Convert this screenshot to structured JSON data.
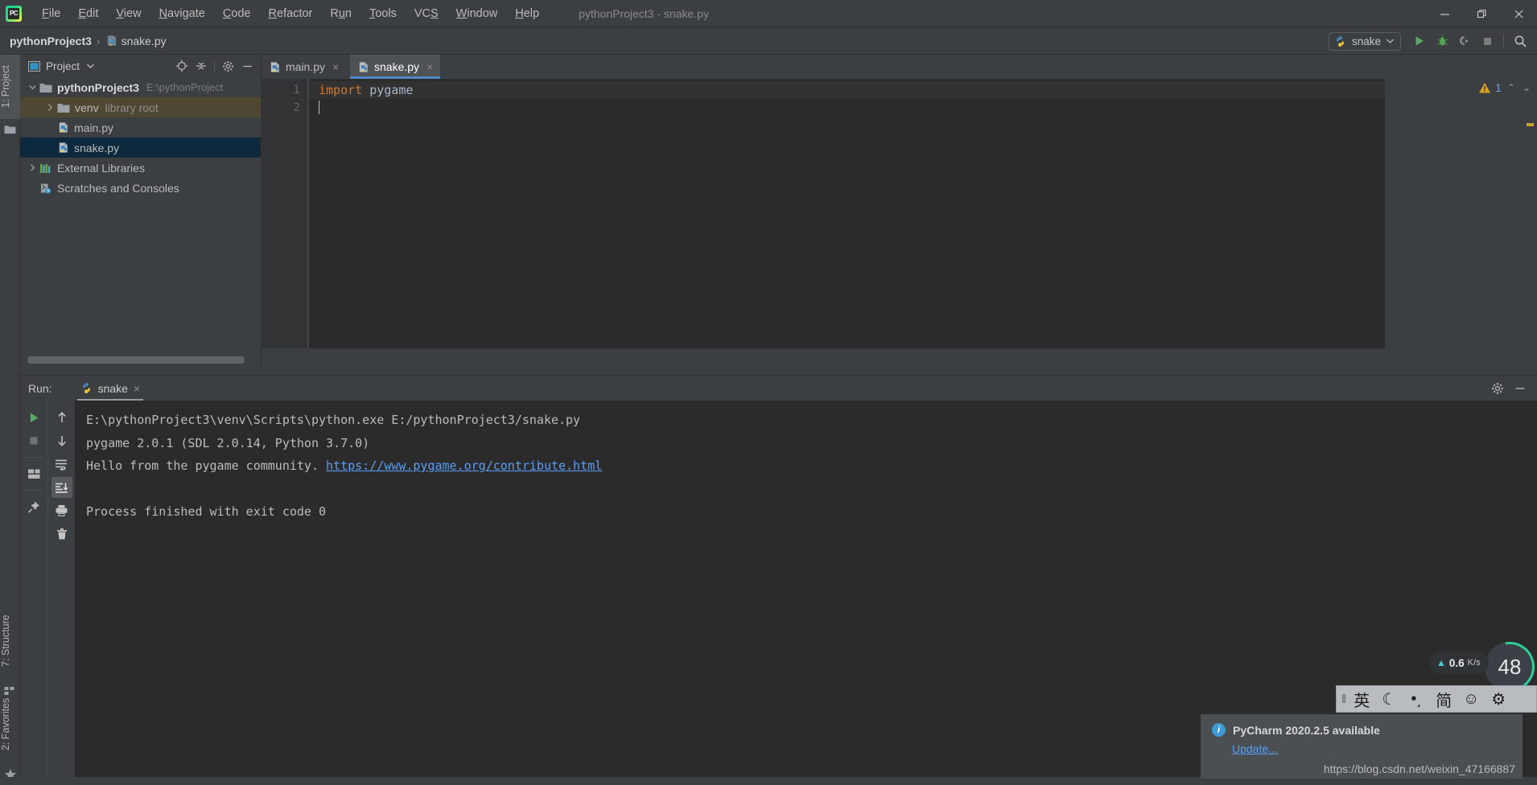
{
  "window": {
    "title": "pythonProject3 - snake.py",
    "app_logo": "pycharm-logo",
    "controls": {
      "minimize": "minimize-icon",
      "maximize": "restore-icon",
      "close": "close-icon"
    }
  },
  "menubar": {
    "items": [
      {
        "label": "File",
        "mnemonic": "F"
      },
      {
        "label": "Edit",
        "mnemonic": "E"
      },
      {
        "label": "View",
        "mnemonic": "V"
      },
      {
        "label": "Navigate",
        "mnemonic": "N"
      },
      {
        "label": "Code",
        "mnemonic": "C"
      },
      {
        "label": "Refactor",
        "mnemonic": "R"
      },
      {
        "label": "Run",
        "mnemonic": "u"
      },
      {
        "label": "Tools",
        "mnemonic": "T"
      },
      {
        "label": "VCS",
        "mnemonic": "S"
      },
      {
        "label": "Window",
        "mnemonic": "W"
      },
      {
        "label": "Help",
        "mnemonic": "H"
      }
    ]
  },
  "navbar": {
    "breadcrumb": {
      "project": "pythonProject3",
      "separator": "›",
      "file": "snake.py"
    },
    "run_config": {
      "name": "snake",
      "icon": "python-icon",
      "chevron": "chevron-down-icon"
    },
    "actions": [
      {
        "name": "run-button",
        "icon": "play-icon",
        "tooltip": "Run"
      },
      {
        "name": "debug-button",
        "icon": "bug-icon",
        "tooltip": "Debug"
      },
      {
        "name": "coverage-button",
        "icon": "coverage-icon",
        "tooltip": "Run with Coverage"
      },
      {
        "name": "stop-button",
        "icon": "stop-icon",
        "tooltip": "Stop"
      },
      {
        "name": "search-button",
        "icon": "search-icon",
        "tooltip": "Search Everywhere"
      }
    ]
  },
  "left_strip": {
    "tabs": [
      {
        "label": "1: Project",
        "icon": "folder-icon",
        "selected": true
      },
      {
        "label": "7: Structure",
        "icon": "structure-icon",
        "selected": false
      },
      {
        "label": "2: Favorites",
        "icon": "star-icon",
        "selected": false
      }
    ]
  },
  "project_panel": {
    "title": "Project",
    "chevron": "chevron-down-icon",
    "tools": [
      {
        "name": "select-opened-file-button",
        "icon": "target-icon"
      },
      {
        "name": "collapse-all-button",
        "icon": "collapse-all-icon"
      },
      {
        "name": "settings-button",
        "icon": "gear-icon"
      },
      {
        "name": "hide-button",
        "icon": "minimize-icon"
      }
    ],
    "tree": [
      {
        "label": "pythonProject3",
        "detail": "E:\\pythonProject",
        "icon": "folder-icon",
        "arrow": "expanded",
        "indent": 0,
        "bold": true,
        "state": "none"
      },
      {
        "label": "venv",
        "detail": "library root",
        "icon": "folder-icon",
        "arrow": "collapsed",
        "indent": 1,
        "bold": false,
        "state": "venv"
      },
      {
        "label": "main.py",
        "detail": "",
        "icon": "python-icon",
        "arrow": "none",
        "indent": 2,
        "bold": false,
        "state": "none"
      },
      {
        "label": "snake.py",
        "detail": "",
        "icon": "python-icon",
        "arrow": "none",
        "indent": 2,
        "bold": false,
        "state": "selected"
      },
      {
        "label": "External Libraries",
        "detail": "",
        "icon": "library-icon",
        "arrow": "collapsed",
        "indent": 0,
        "bold": false,
        "state": "none"
      },
      {
        "label": "Scratches and Consoles",
        "detail": "",
        "icon": "scratch-icon",
        "arrow": "none",
        "indent": 0,
        "bold": false,
        "state": "none"
      }
    ]
  },
  "editor": {
    "tabs": [
      {
        "label": "main.py",
        "icon": "python-icon",
        "active": false,
        "close": "×"
      },
      {
        "label": "snake.py",
        "icon": "python-icon",
        "active": true,
        "close": "×"
      }
    ],
    "line_numbers": [
      "1",
      "2"
    ],
    "lines": [
      {
        "text": "import pygame",
        "current": true
      },
      {
        "text": "",
        "current": false
      }
    ],
    "inspection": {
      "warning_icon": "warning-triangle-icon",
      "warning_count": "1",
      "up": "⌃",
      "down": "⌄"
    }
  },
  "run_panel": {
    "header_label": "Run:",
    "tab": {
      "label": "snake",
      "icon": "python-icon",
      "close": "×"
    },
    "header_actions": [
      {
        "name": "run-settings-button",
        "icon": "gear-icon"
      },
      {
        "name": "hide-panel-button",
        "icon": "minimize-icon"
      }
    ],
    "toolbar_left": [
      {
        "name": "rerun-button",
        "icon": "play-icon"
      },
      {
        "name": "stop-button",
        "icon": "stop-icon"
      },
      {
        "name": "layout-button",
        "icon": "layout-icon"
      },
      {
        "name": "pin-tab-button",
        "icon": "pin-icon"
      }
    ],
    "toolbar_right": [
      {
        "name": "up-the-stack-button",
        "icon": "arrow-up-icon"
      },
      {
        "name": "down-the-stack-button",
        "icon": "arrow-down-icon"
      },
      {
        "name": "soft-wrap-button",
        "icon": "wrap-icon"
      },
      {
        "name": "scroll-to-end-button",
        "icon": "scroll-end-icon",
        "active": true
      },
      {
        "name": "print-button",
        "icon": "printer-icon"
      },
      {
        "name": "clear-all-button",
        "icon": "trash-icon"
      }
    ],
    "console": [
      {
        "type": "text",
        "text": "E:\\pythonProject3\\venv\\Scripts\\python.exe E:/pythonProject3/snake.py"
      },
      {
        "type": "text",
        "text": "pygame 2.0.1 (SDL 2.0.14, Python 3.7.0)"
      },
      {
        "type": "link_line",
        "text": "Hello from the pygame community. ",
        "link": "https://www.pygame.org/contribute.html"
      },
      {
        "type": "blank",
        "text": ""
      },
      {
        "type": "text",
        "text": "Process finished with exit code 0"
      }
    ]
  },
  "overlays": {
    "network_widget": {
      "arrow": "arrow-up-icon",
      "value": "0.6",
      "unit": "K/s"
    },
    "gauge": {
      "value": "48"
    },
    "ime_bar": {
      "grip": "grip-icon",
      "items": [
        {
          "label": "英",
          "name": "ime-language-english"
        },
        {
          "label": "☾",
          "name": "ime-moon-icon"
        },
        {
          "label": "•͵",
          "name": "ime-punctuation-icon"
        },
        {
          "label": "简",
          "name": "ime-simplified-chinese"
        },
        {
          "label": "☺",
          "name": "ime-emoji-icon"
        },
        {
          "label": "⚙",
          "name": "ime-settings-icon"
        }
      ]
    },
    "notification": {
      "icon": "info-icon",
      "title": "PyCharm 2020.2.5 available",
      "action": "Update...",
      "watermark": "https://blog.csdn.net/weixin_47166887"
    }
  },
  "colors": {
    "background": "#3c3f41",
    "editor_background": "#2b2b2b",
    "accent_blue": "#4a88c7",
    "link_blue": "#589df6",
    "selection_blue": "#0d293e",
    "venv_highlight": "#4e4832",
    "green_run": "#59a869",
    "warning_yellow": "#d9a022"
  }
}
